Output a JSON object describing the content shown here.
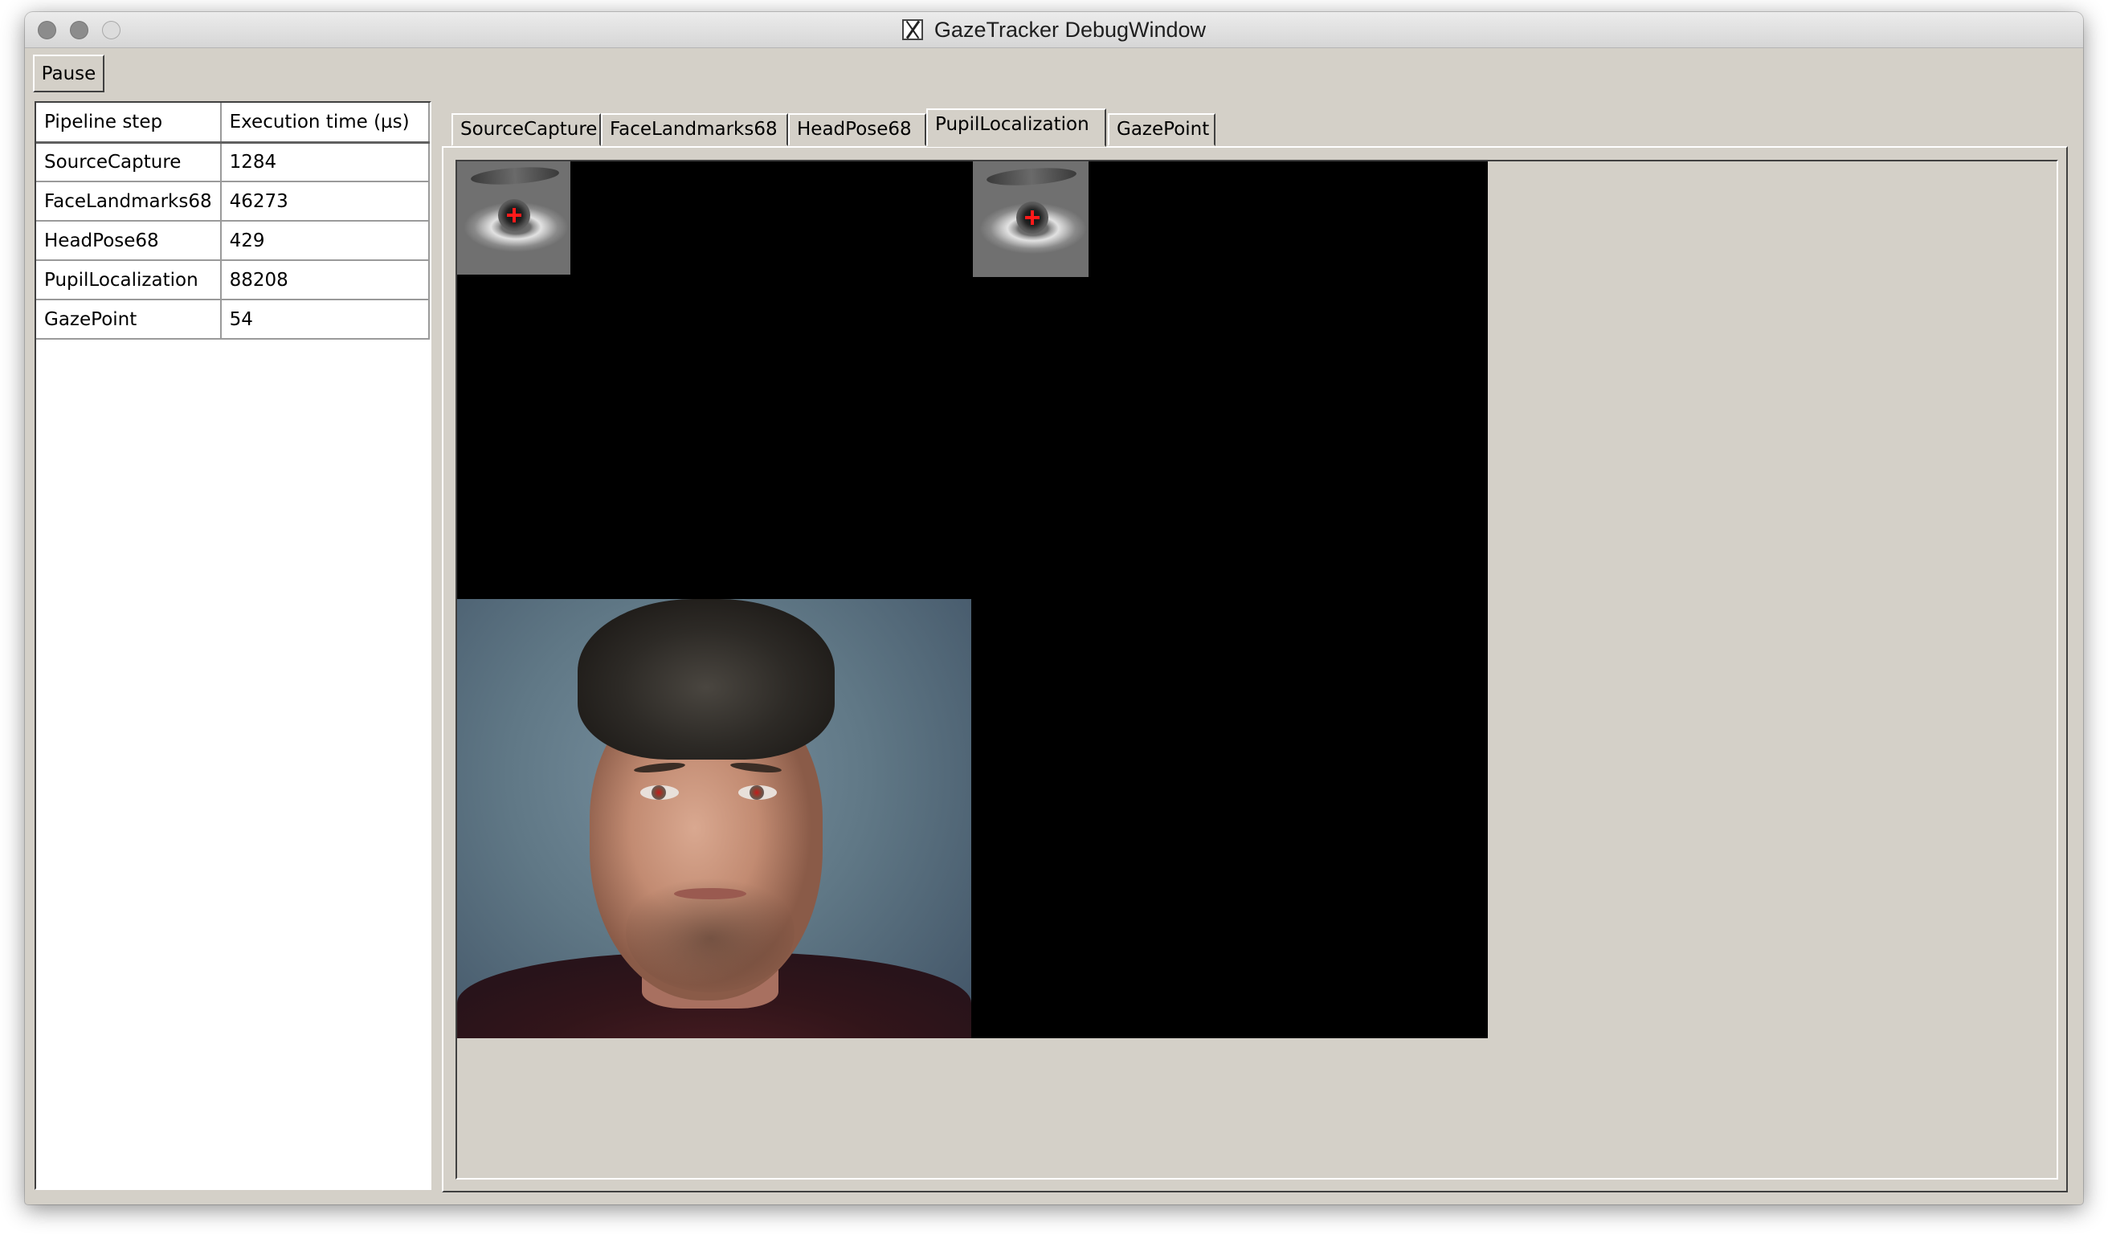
{
  "window": {
    "title": "GazeTracker DebugWindow"
  },
  "toolbar": {
    "pause_label": "Pause"
  },
  "table": {
    "headers": [
      "Pipeline step",
      "Execution time (µs)"
    ],
    "rows": [
      {
        "step": "SourceCapture",
        "time": "1284"
      },
      {
        "step": "FaceLandmarks68",
        "time": "46273"
      },
      {
        "step": "HeadPose68",
        "time": "429"
      },
      {
        "step": "PupilLocalization",
        "time": "88208"
      },
      {
        "step": "GazePoint",
        "time": "54"
      }
    ]
  },
  "tabs": [
    {
      "label": "SourceCapture",
      "active": false
    },
    {
      "label": "FaceLandmarks68",
      "active": false
    },
    {
      "label": "HeadPose68",
      "active": false
    },
    {
      "label": "PupilLocalization",
      "active": true
    },
    {
      "label": "GazePoint",
      "active": false
    }
  ],
  "colors": {
    "window_bg": "#d4d0c8",
    "canvas_bg": "#000000",
    "pupil_marker": "#ff1a1a"
  },
  "icons": {
    "app_icon": "x11-icon"
  }
}
